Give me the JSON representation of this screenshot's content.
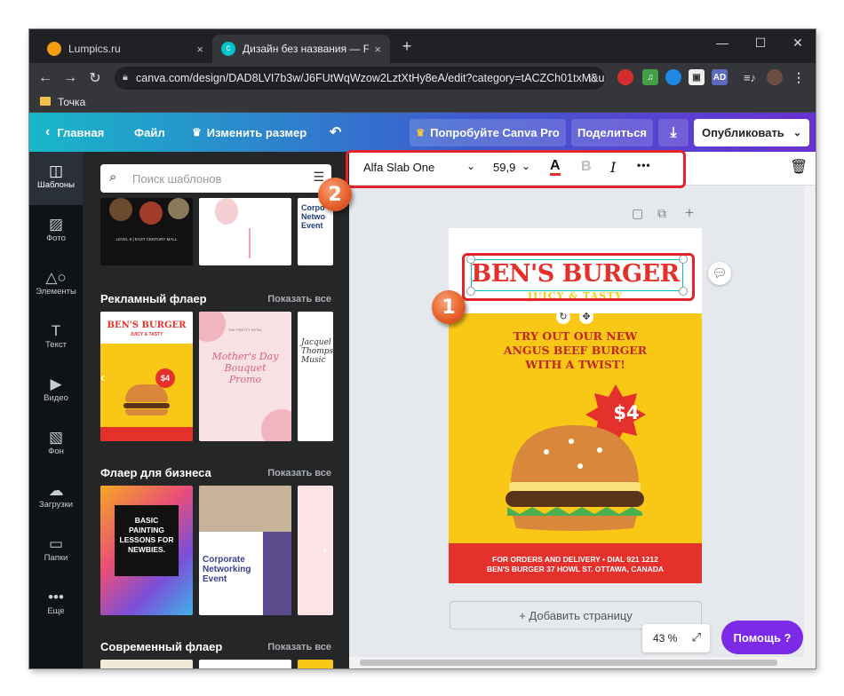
{
  "browser": {
    "tabs": [
      {
        "title": "Lumpics.ru",
        "close": "×"
      },
      {
        "title": "Дизайн без названия — Flyer (A",
        "close": "×"
      }
    ],
    "new_tab": "+",
    "window_controls": [
      "—",
      "☐",
      "✕"
    ],
    "url": "canva.com/design/DAD8LVI7b3w/J6FUtWqWzow2LztXtHy8eA/edit?category=tACZCh01txM&u...",
    "bookmark": "Точка"
  },
  "header": {
    "back": "Главная",
    "file": "Файл",
    "resize": "Изменить размер",
    "try_pro": "Попробуйте Canva Pro",
    "share": "Поделиться",
    "publish": "Опубликовать"
  },
  "rail": [
    {
      "label": "Шаблоны",
      "icon": "templates-icon"
    },
    {
      "label": "Фото",
      "icon": "photo-icon"
    },
    {
      "label": "Элементы",
      "icon": "elements-icon"
    },
    {
      "label": "Текст",
      "icon": "text-icon"
    },
    {
      "label": "Видео",
      "icon": "video-icon"
    },
    {
      "label": "Фон",
      "icon": "background-icon"
    },
    {
      "label": "Загрузки",
      "icon": "upload-icon"
    },
    {
      "label": "Папки",
      "icon": "folder-icon"
    },
    {
      "label": "Еще",
      "icon": "more-icon"
    }
  ],
  "panel": {
    "search_placeholder": "Поиск шаблонов",
    "see_all": "Показать все",
    "sections": [
      "Рекламный флаер",
      "Флаер для бизнеса",
      "Современный флаер"
    ],
    "thumbs": {
      "mall": "LEVEL 5 | EAST CENTURY MALL",
      "corp_partial": "Corpo Netwo Event",
      "burger_title": "BEN'S BURGER",
      "burger_sub": "JUICY & TASTY",
      "burger_price": "$4",
      "mothers": "Mother's Day Bouquet Promo",
      "mothers_top": "THE PRETTY PETAL",
      "music": "Jacquel Thomps Music",
      "paint": "BASIC PAINTING LESSONS FOR NEWBIES.",
      "corporate": "Corporate Networking Event"
    }
  },
  "toolbar": {
    "font": "Alfa Slab One",
    "size": "59,9",
    "color_letter": "A",
    "bold": "B",
    "italic": "I",
    "more": "•••"
  },
  "poster": {
    "title": "BEN'S BURGER",
    "subtitle": "JUICY & TASTY",
    "tagline": [
      "TRY OUT OUR NEW",
      "ANGUS BEEF BURGER",
      "WITH A TWIST!"
    ],
    "price": "$4",
    "footer": [
      "FOR ORDERS AND DELIVERY • DIAL 921 1212",
      "BEN'S BURGER 37 HOWL ST. OTTAWA, CANADA"
    ]
  },
  "add_page": "+ Добавить страницу",
  "zoom": "43 %",
  "help": "Помощь ?",
  "annotations": [
    "1",
    "2"
  ],
  "colors": {
    "accent": "#7d2ae8",
    "highlight": "#e2242b",
    "poster_yellow": "#f9c817",
    "poster_red": "#e4312b"
  }
}
